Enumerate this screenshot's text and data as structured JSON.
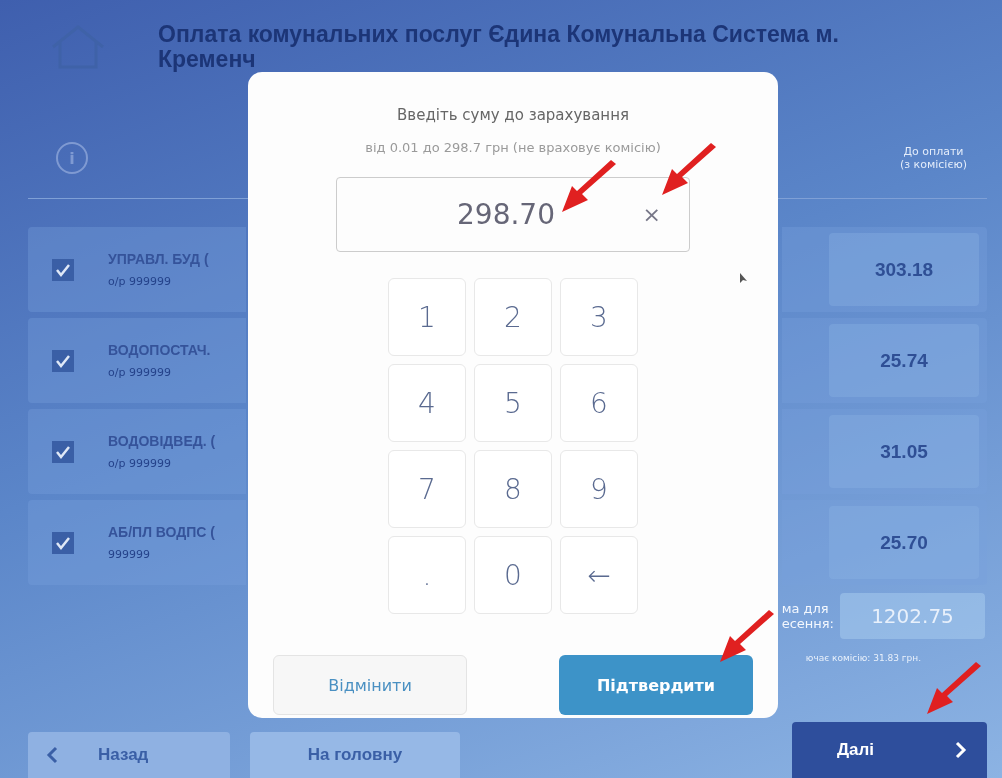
{
  "header": {
    "title_lines": [
      "Оплата комунальних послуг Єдина Комунальна Система м.",
      "Кременч"
    ]
  },
  "table": {
    "info": "i",
    "column_header_lines": [
      "До оплати",
      "(з комісією)"
    ]
  },
  "rows": [
    {
      "checked": true,
      "name": "УПРАВЛ. БУД (",
      "account": "о/р 999999",
      "amount": "303.18"
    },
    {
      "checked": true,
      "name": "ВОДОПОСТАЧ.",
      "account": "о/р 999999",
      "amount": "25.74"
    },
    {
      "checked": true,
      "name": "ВОДОВІДВЕД. (",
      "account": "о/р 999999",
      "amount": "31.05"
    },
    {
      "checked": true,
      "name": "АБ/ПЛ ВОДПС (",
      "account": "999999",
      "amount": "25.70"
    }
  ],
  "summary": {
    "label_lines": [
      "ма для",
      "есення:"
    ],
    "total": "1202.75",
    "note": "ючає комісію: 31.83 грн."
  },
  "dialog": {
    "title": "Введіть суму до зарахування",
    "hint": "від 0.01 до 298.7 грн (не враховує комісію)",
    "value": "298.70",
    "clear": "×",
    "keys": [
      "1",
      "2",
      "3",
      "4",
      "5",
      "6",
      "7",
      "8",
      "9",
      ".",
      "0",
      "←"
    ],
    "buttons": [
      {
        "label": "Відмінити",
        "kind": "secondary"
      },
      {
        "label": "Підтвердити",
        "kind": "primary"
      }
    ]
  },
  "nav": [
    {
      "label": "Назад",
      "kind": "back"
    },
    {
      "label": "На головну",
      "kind": "home"
    },
    {
      "label": "Далі",
      "kind": "next"
    }
  ]
}
